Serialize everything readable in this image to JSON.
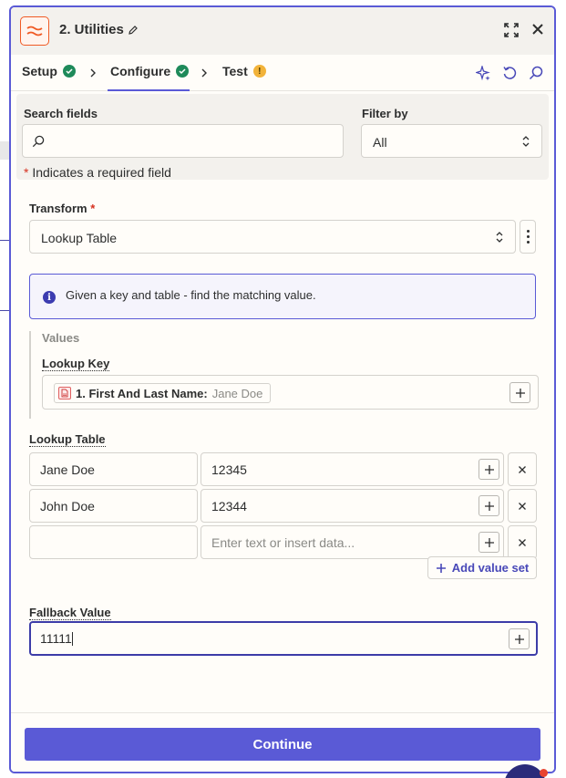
{
  "header": {
    "title": "2. Utilities"
  },
  "tabs": [
    {
      "label": "Setup",
      "status": "complete"
    },
    {
      "label": "Configure",
      "status": "complete"
    },
    {
      "label": "Test",
      "status": "warning",
      "status_glyph": "!"
    }
  ],
  "search": {
    "label": "Search fields",
    "value": "",
    "placeholder": ""
  },
  "filter": {
    "label": "Filter by",
    "selected": "All"
  },
  "required_note": "Indicates a required field",
  "required_star": "*",
  "transform": {
    "label": "Transform",
    "selected": "Lookup Table"
  },
  "info": {
    "glyph": "i",
    "text": "Given a key and table - find the matching value."
  },
  "values": {
    "title": "Values",
    "lookup_key": {
      "label": "Lookup Key",
      "pill_key": "1. First And Last Name:",
      "pill_value": "Jane Doe"
    }
  },
  "lookup_table": {
    "label": "Lookup Table",
    "rows": [
      {
        "key": "Jane Doe",
        "value": "12345"
      },
      {
        "key": "John Doe",
        "value": "12344"
      },
      {
        "key": "",
        "value": "",
        "placeholder": "Enter text or insert data..."
      }
    ],
    "add_label": "Add value set"
  },
  "fallback": {
    "label": "Fallback Value",
    "value": "11111"
  },
  "footer": {
    "continue_label": "Continue"
  },
  "colors": {
    "accent": "#5a5ad6",
    "app_icon": "#f05a24",
    "success": "#1e8a5a",
    "warning": "#f2b33a",
    "required": "#d6301f"
  },
  "icons": [
    "app-icon",
    "pencil-icon",
    "expand-icon",
    "close-icon",
    "check-icon",
    "chevron-right-icon",
    "warning-icon",
    "sparkle-icon",
    "undo-icon",
    "search-icon",
    "updown-icon",
    "more-vertical-icon",
    "info-icon",
    "plus-icon",
    "x-icon",
    "chat-icon"
  ]
}
